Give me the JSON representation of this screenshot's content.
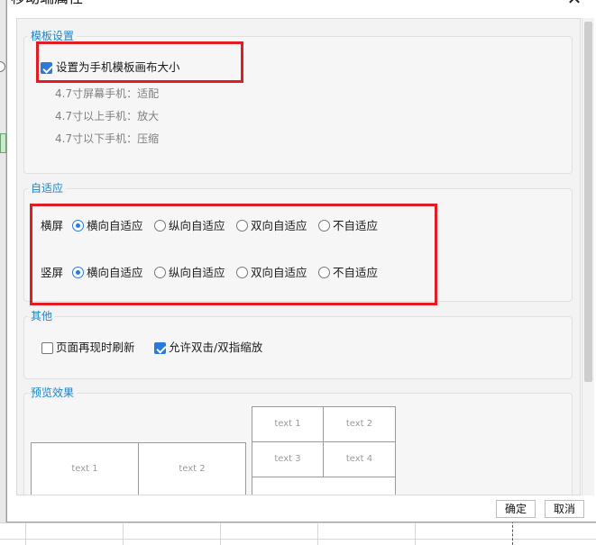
{
  "dialog": {
    "title": "移动端属性",
    "close_icon": "close-icon"
  },
  "template_settings": {
    "title": "模板设置",
    "set_canvas_label": "设置为手机模板画布大小",
    "set_canvas_checked": true,
    "notes": [
      "4.7寸屏幕手机：适配",
      "4.7寸以上手机：放大",
      "4.7寸以下手机：压缩"
    ]
  },
  "adaptive": {
    "title": "自适应",
    "rows": [
      {
        "label": "横屏",
        "options": [
          "横向自适应",
          "纵向自适应",
          "双向自适应",
          "不自适应"
        ],
        "selected": 0
      },
      {
        "label": "竖屏",
        "options": [
          "横向自适应",
          "纵向自适应",
          "双向自适应",
          "不自适应"
        ],
        "selected": 0
      }
    ]
  },
  "other": {
    "title": "其他",
    "refresh_label": "页面再现时刷新",
    "refresh_checked": false,
    "zoom_label": "允许双击/双指缩放",
    "zoom_checked": true
  },
  "preview": {
    "title": "预览效果",
    "landscape_cells": [
      "text 1",
      "text 2"
    ],
    "portrait_cells": [
      "text 1",
      "text 2",
      "text 3",
      "text 4"
    ]
  },
  "buttons": {
    "ok_label": "确定",
    "cancel_label": "取消"
  },
  "colors": {
    "accent": "#1d86c8",
    "check": "#2b79d8",
    "highlight": "#e31b23"
  }
}
